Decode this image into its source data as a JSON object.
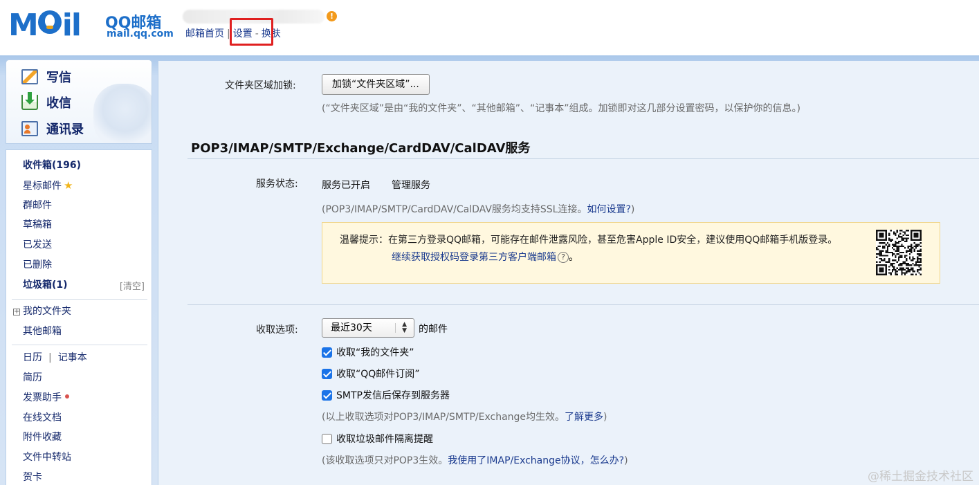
{
  "header": {
    "logo_text": "Mail",
    "brand_cn": "QQ邮箱",
    "brand_url": "mail.qq.com",
    "warning_glyph": "!",
    "nav": {
      "home": "邮箱首页",
      "sep1": "|",
      "settings": "设置",
      "sep2": "-",
      "skin": "换肤"
    }
  },
  "sidebar": {
    "quick": {
      "compose": "写信",
      "inbox": "收信",
      "contacts": "通讯录"
    },
    "folders": {
      "inbox": "收件箱(196)",
      "starred": "星标邮件",
      "group": "群邮件",
      "drafts": "草稿箱",
      "sent": "已发送",
      "deleted": "已删除",
      "trash": "垃圾箱(1)",
      "trash_clear": "[清空]",
      "my_folders": "我的文件夹",
      "other_mailboxes": "其他邮箱",
      "calendar": "日历",
      "calendar_sep": "|",
      "notes": "记事本",
      "resume": "简历",
      "invoice": "发票助手",
      "online_docs": "在线文档",
      "attachments": "附件收藏",
      "file_transfer": "文件中转站",
      "cards": "贺卡"
    }
  },
  "main": {
    "folder_lock": {
      "label": "文件夹区域加锁:",
      "button": "加锁“文件夹区域”...",
      "hint": "(“文件夹区域”是由“我的文件夹”、“其他邮箱”、“记事本”组成。加锁即对这几部分设置密码，以保护你的信息。)"
    },
    "pop_section": {
      "title": "POP3/IMAP/SMTP/Exchange/CardDAV/CalDAV服务",
      "status_label": "服务状态:",
      "status_value": "服务已开启",
      "manage_link": "管理服务",
      "ssl_hint_pre": "(POP3/IMAP/SMTP/CardDAV/CalDAV服务均支持SSL连接。",
      "ssl_hint_link": "如何设置?",
      "ssl_hint_post": ")",
      "tip_line1": "温馨提示：在第三方登录QQ邮箱，可能存在邮件泄露风险，甚至危害Apple ID安全，建议使用QQ邮箱手机版登录。",
      "tip_line2_link": "继续获取授权码登录第三方客户端邮箱",
      "tip_help": "?",
      "tip_line2_end": "。"
    },
    "fetch": {
      "label": "收取选项:",
      "select_value": "最近30天",
      "select_suffix": "的邮件",
      "opt_my_folders": "收取“我的文件夹”",
      "opt_qq_subscription": "收取“QQ邮件订阅”",
      "opt_smtp_save": "SMTP发信后保存到服务器",
      "hint1_pre": "(以上收取选项对POP3/IMAP/SMTP/Exchange均生效。",
      "hint1_link": "了解更多",
      "hint1_post": ")",
      "opt_spam_alert": "收取垃圾邮件隔离提醒",
      "hint2_pre": "(该收取选项只对POP3生效。",
      "hint2_link": "我使用了IMAP/Exchange协议，怎么办?",
      "hint2_post": ")"
    }
  },
  "checkbox_state": {
    "my_folders": true,
    "qq_subscription": true,
    "smtp_save": true,
    "spam_alert": false
  },
  "watermark": "@稀土掘金技术社区",
  "colors": {
    "brand_blue": "#1d6fc9",
    "link": "#1a3a8e",
    "tip_bg": "#fff8df",
    "highlight": "#e02020",
    "checkbox": "#1a73e8"
  }
}
